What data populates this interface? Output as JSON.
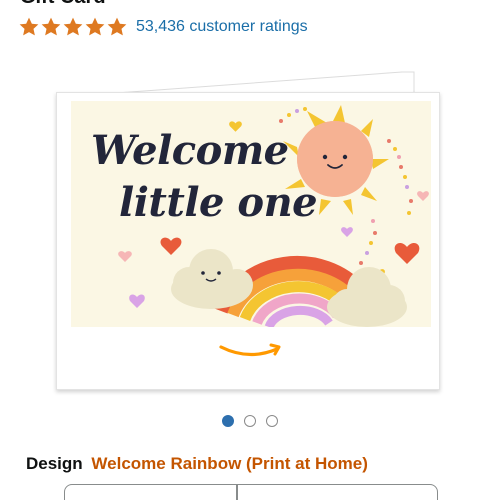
{
  "product": {
    "title_partial": "Gift Card",
    "rating": {
      "stars": 5,
      "count_text": "53,436 customer ratings"
    }
  },
  "card_image": {
    "headline_line1": "Welcome",
    "headline_line2": "little one",
    "brand_logo": "amazon-smile-icon"
  },
  "carousel": {
    "total": 3,
    "active_index": 0
  },
  "design": {
    "label": "Design",
    "value": "Welcome Rainbow (Print at Home)"
  },
  "colors": {
    "star": "#de7921",
    "link": "#1a6ea8",
    "design_value": "#c45500",
    "active_dot": "#2d6fae",
    "amazon_orange": "#ff9900"
  }
}
